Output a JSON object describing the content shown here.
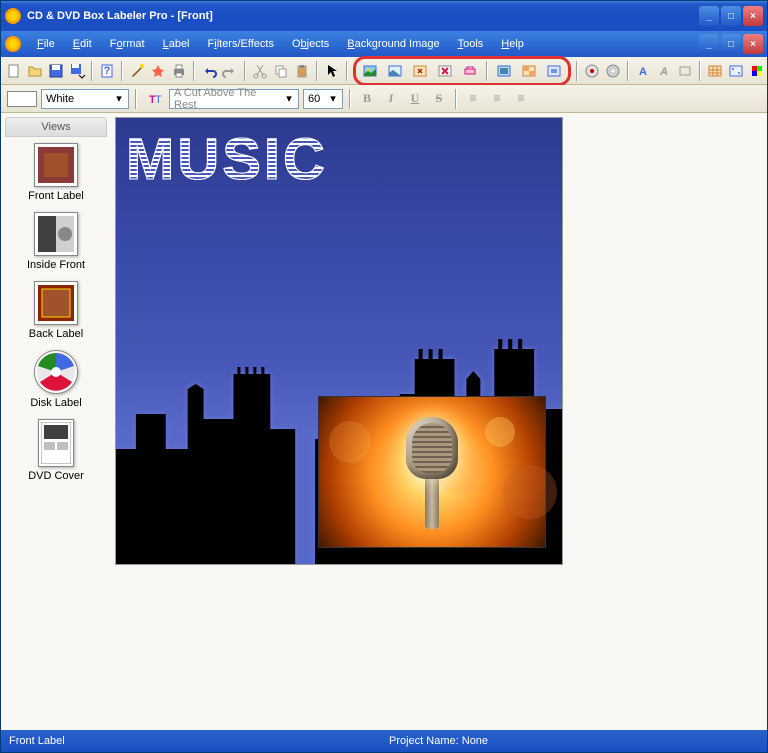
{
  "title": "CD & DVD Box Labeler Pro - [Front]",
  "menu": {
    "file": "File",
    "edit": "Edit",
    "format": "Format",
    "label": "Label",
    "filters": "Filters/Effects",
    "objects": "Objects",
    "background": "Background Image",
    "tools": "Tools",
    "help": "Help"
  },
  "color": {
    "name": "White"
  },
  "font": {
    "name": "A Cut Above The Rest",
    "size": "60"
  },
  "views": {
    "header": "Views",
    "items": [
      "Front Label",
      "Inside Front",
      "Back Label",
      "Disk Label",
      "DVD Cover"
    ]
  },
  "canvas": {
    "heading": "MUSIC"
  },
  "status": {
    "left": "Front Label",
    "right": "Project Name: None"
  },
  "winbtns": {
    "min": "_",
    "max": "□",
    "close": "×"
  },
  "fmt": {
    "b": "B",
    "i": "I",
    "u": "U",
    "s": "S",
    "l": "≡",
    "c": "≡",
    "r": "≡"
  }
}
